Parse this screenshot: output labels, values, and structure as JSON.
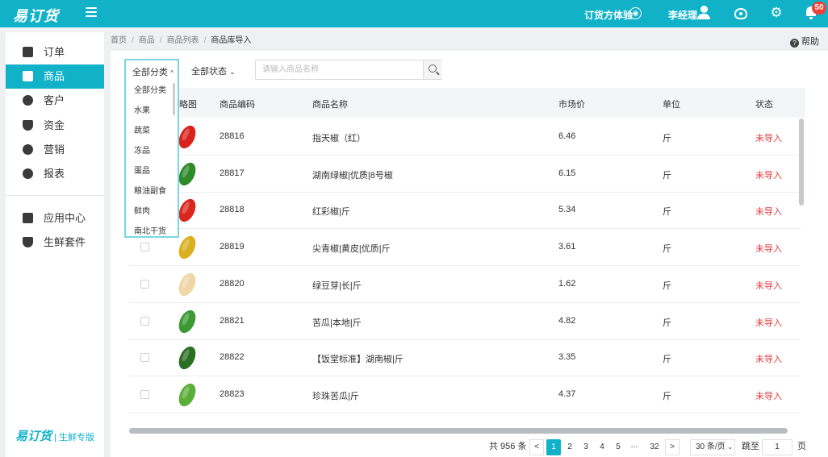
{
  "app": {
    "logo": "易订货"
  },
  "topbar": {
    "experience": "订货方体验",
    "user": "李经理",
    "notify_count": "50"
  },
  "sidebar": {
    "items": [
      {
        "label": "订单",
        "icon": "order-icon"
      },
      {
        "label": "商品",
        "icon": "goods-icon",
        "active": true
      },
      {
        "label": "客户",
        "icon": "customer-icon"
      },
      {
        "label": "资金",
        "icon": "fund-icon"
      },
      {
        "label": "营销",
        "icon": "marketing-icon"
      },
      {
        "label": "报表",
        "icon": "report-icon"
      },
      {
        "label": "应用中心",
        "icon": "app-center-icon"
      },
      {
        "label": "生鲜套件",
        "icon": "fresh-kit-icon"
      }
    ],
    "footer_logo": "易订货",
    "footer_text": "| 生鲜专版"
  },
  "breadcrumb": {
    "home": "首页",
    "goods": "商品",
    "list": "商品列表",
    "current": "商品库导入"
  },
  "help": "帮助",
  "filters": {
    "category": "全部分类",
    "status": "全部状态",
    "search_placeholder": "请输入商品名称"
  },
  "dropdown": {
    "options": [
      "全部分类",
      "水果",
      "蔬菜",
      "冻品",
      "蛋品",
      "粮油副食",
      "鲜肉",
      "南北干货"
    ]
  },
  "table": {
    "headers": {
      "image": "略图",
      "code": "商品编码",
      "name": "商品名称",
      "price": "市场价",
      "unit": "单位",
      "status": "状态"
    },
    "rows": [
      {
        "code": "28816",
        "name": "指天椒（红）",
        "price": "6.46",
        "unit": "斤",
        "status": "未导入",
        "color": "#d8231c"
      },
      {
        "code": "28817",
        "name": "湖南绿椒|优质|8号椒",
        "price": "6.15",
        "unit": "斤",
        "status": "未导入",
        "color": "#2f8a2a"
      },
      {
        "code": "28818",
        "name": "红彩椒|斤",
        "price": "5.34",
        "unit": "斤",
        "status": "未导入",
        "color": "#d9271f"
      },
      {
        "code": "28819",
        "name": "尖青椒|黄皮|优质|斤",
        "price": "3.61",
        "unit": "斤",
        "status": "未导入",
        "color": "#d8b020"
      },
      {
        "code": "28820",
        "name": "绿豆芽|长|斤",
        "price": "1.62",
        "unit": "斤",
        "status": "未导入",
        "color": "#efd7a8"
      },
      {
        "code": "28821",
        "name": "苦瓜|本地|斤",
        "price": "4.82",
        "unit": "斤",
        "status": "未导入",
        "color": "#3c9a36"
      },
      {
        "code": "28822",
        "name": "【饭堂标准】湖南椒|斤",
        "price": "3.35",
        "unit": "斤",
        "status": "未导入",
        "color": "#2b6f22"
      },
      {
        "code": "28823",
        "name": "珍珠苦瓜|斤",
        "price": "4.37",
        "unit": "斤",
        "status": "未导入",
        "color": "#5cae3a"
      }
    ]
  },
  "pagination": {
    "total": "共 956 条",
    "prev": "<",
    "pages": [
      "1",
      "2",
      "3",
      "4",
      "5"
    ],
    "ellipsis": "•••",
    "last": "32",
    "next": ">",
    "size": "30 条/页",
    "jump_label": "跳至",
    "jump_value": "1",
    "page_suffix": "页"
  }
}
